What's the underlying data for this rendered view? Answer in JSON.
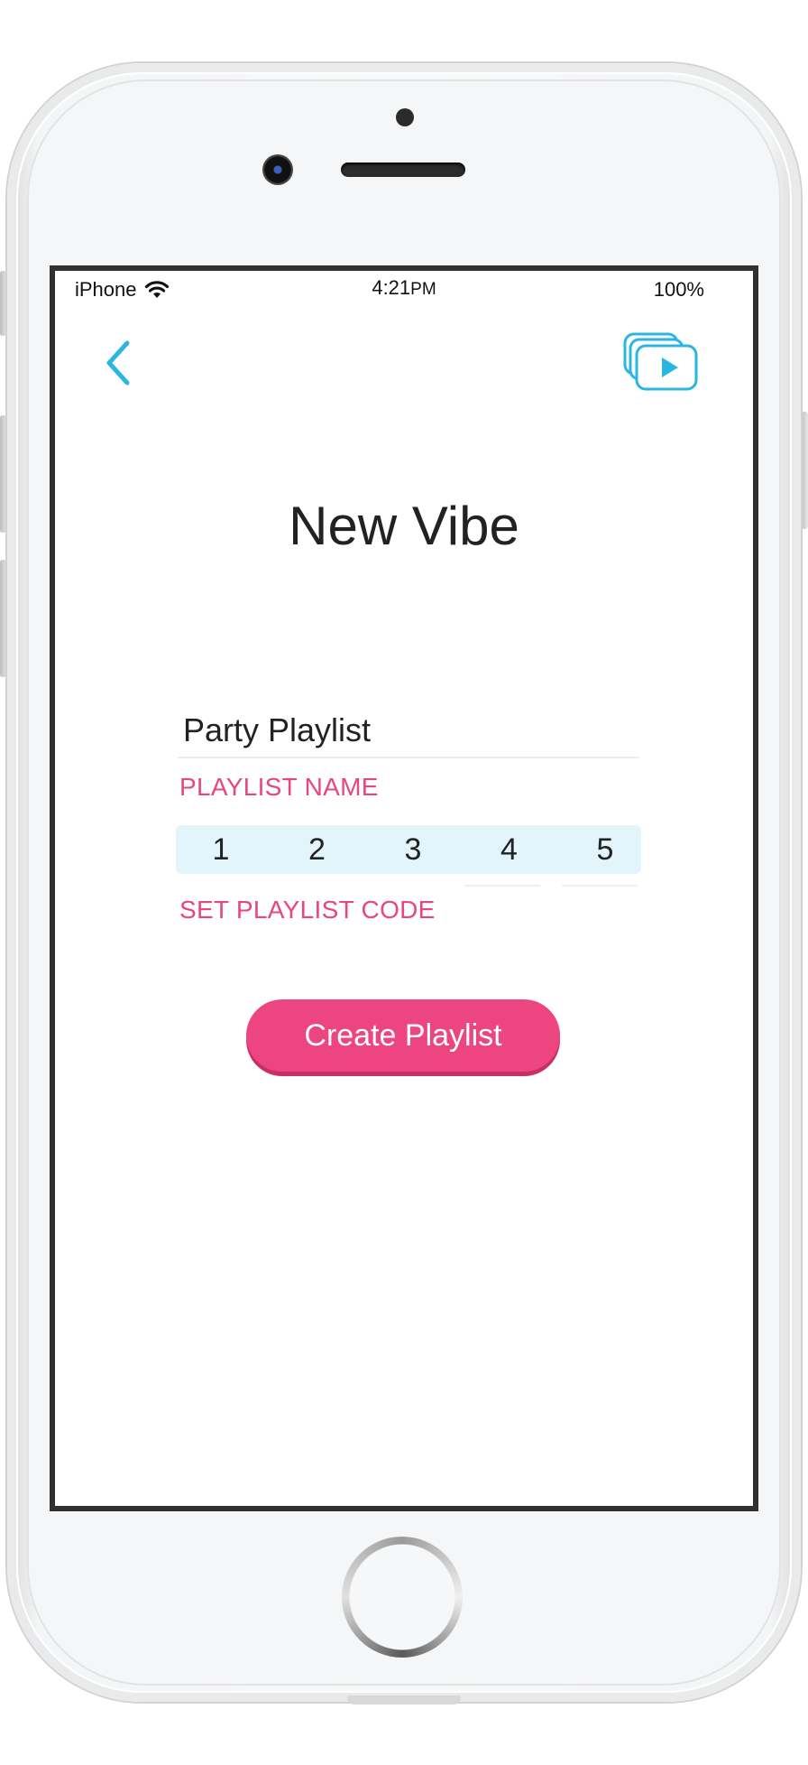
{
  "status_bar": {
    "carrier": "iPhone",
    "time": "4:21",
    "time_suffix": "PM",
    "battery": "100%"
  },
  "nav": {
    "back_icon": "chevron-left-icon",
    "playlists_icon": "stacked-playlists-play-icon"
  },
  "page": {
    "title": "New Vibe"
  },
  "form": {
    "name_value": "Party Playlist",
    "name_label": "PLAYLIST NAME",
    "code_digits": [
      "1",
      "2",
      "3",
      "4",
      "5"
    ],
    "code_label": "SET PLAYLIST CODE",
    "submit_label": "Create Playlist"
  },
  "colors": {
    "accent_blue": "#29b6e0",
    "accent_pink": "#ec4580",
    "code_background": "#e2f5fa"
  }
}
